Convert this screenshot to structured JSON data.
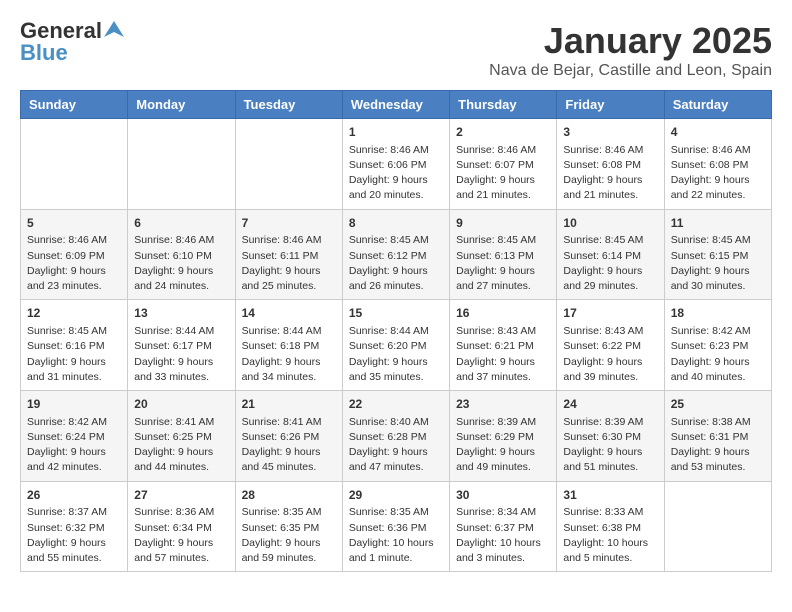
{
  "header": {
    "logo_general": "General",
    "logo_blue": "Blue",
    "title": "January 2025",
    "subtitle": "Nava de Bejar, Castille and Leon, Spain"
  },
  "calendar": {
    "headers": [
      "Sunday",
      "Monday",
      "Tuesday",
      "Wednesday",
      "Thursday",
      "Friday",
      "Saturday"
    ],
    "weeks": [
      [
        {
          "day": "",
          "content": ""
        },
        {
          "day": "",
          "content": ""
        },
        {
          "day": "",
          "content": ""
        },
        {
          "day": "1",
          "content": "Sunrise: 8:46 AM\nSunset: 6:06 PM\nDaylight: 9 hours\nand 20 minutes."
        },
        {
          "day": "2",
          "content": "Sunrise: 8:46 AM\nSunset: 6:07 PM\nDaylight: 9 hours\nand 21 minutes."
        },
        {
          "day": "3",
          "content": "Sunrise: 8:46 AM\nSunset: 6:08 PM\nDaylight: 9 hours\nand 21 minutes."
        },
        {
          "day": "4",
          "content": "Sunrise: 8:46 AM\nSunset: 6:08 PM\nDaylight: 9 hours\nand 22 minutes."
        }
      ],
      [
        {
          "day": "5",
          "content": "Sunrise: 8:46 AM\nSunset: 6:09 PM\nDaylight: 9 hours\nand 23 minutes."
        },
        {
          "day": "6",
          "content": "Sunrise: 8:46 AM\nSunset: 6:10 PM\nDaylight: 9 hours\nand 24 minutes."
        },
        {
          "day": "7",
          "content": "Sunrise: 8:46 AM\nSunset: 6:11 PM\nDaylight: 9 hours\nand 25 minutes."
        },
        {
          "day": "8",
          "content": "Sunrise: 8:45 AM\nSunset: 6:12 PM\nDaylight: 9 hours\nand 26 minutes."
        },
        {
          "day": "9",
          "content": "Sunrise: 8:45 AM\nSunset: 6:13 PM\nDaylight: 9 hours\nand 27 minutes."
        },
        {
          "day": "10",
          "content": "Sunrise: 8:45 AM\nSunset: 6:14 PM\nDaylight: 9 hours\nand 29 minutes."
        },
        {
          "day": "11",
          "content": "Sunrise: 8:45 AM\nSunset: 6:15 PM\nDaylight: 9 hours\nand 30 minutes."
        }
      ],
      [
        {
          "day": "12",
          "content": "Sunrise: 8:45 AM\nSunset: 6:16 PM\nDaylight: 9 hours\nand 31 minutes."
        },
        {
          "day": "13",
          "content": "Sunrise: 8:44 AM\nSunset: 6:17 PM\nDaylight: 9 hours\nand 33 minutes."
        },
        {
          "day": "14",
          "content": "Sunrise: 8:44 AM\nSunset: 6:18 PM\nDaylight: 9 hours\nand 34 minutes."
        },
        {
          "day": "15",
          "content": "Sunrise: 8:44 AM\nSunset: 6:20 PM\nDaylight: 9 hours\nand 35 minutes."
        },
        {
          "day": "16",
          "content": "Sunrise: 8:43 AM\nSunset: 6:21 PM\nDaylight: 9 hours\nand 37 minutes."
        },
        {
          "day": "17",
          "content": "Sunrise: 8:43 AM\nSunset: 6:22 PM\nDaylight: 9 hours\nand 39 minutes."
        },
        {
          "day": "18",
          "content": "Sunrise: 8:42 AM\nSunset: 6:23 PM\nDaylight: 9 hours\nand 40 minutes."
        }
      ],
      [
        {
          "day": "19",
          "content": "Sunrise: 8:42 AM\nSunset: 6:24 PM\nDaylight: 9 hours\nand 42 minutes."
        },
        {
          "day": "20",
          "content": "Sunrise: 8:41 AM\nSunset: 6:25 PM\nDaylight: 9 hours\nand 44 minutes."
        },
        {
          "day": "21",
          "content": "Sunrise: 8:41 AM\nSunset: 6:26 PM\nDaylight: 9 hours\nand 45 minutes."
        },
        {
          "day": "22",
          "content": "Sunrise: 8:40 AM\nSunset: 6:28 PM\nDaylight: 9 hours\nand 47 minutes."
        },
        {
          "day": "23",
          "content": "Sunrise: 8:39 AM\nSunset: 6:29 PM\nDaylight: 9 hours\nand 49 minutes."
        },
        {
          "day": "24",
          "content": "Sunrise: 8:39 AM\nSunset: 6:30 PM\nDaylight: 9 hours\nand 51 minutes."
        },
        {
          "day": "25",
          "content": "Sunrise: 8:38 AM\nSunset: 6:31 PM\nDaylight: 9 hours\nand 53 minutes."
        }
      ],
      [
        {
          "day": "26",
          "content": "Sunrise: 8:37 AM\nSunset: 6:32 PM\nDaylight: 9 hours\nand 55 minutes."
        },
        {
          "day": "27",
          "content": "Sunrise: 8:36 AM\nSunset: 6:34 PM\nDaylight: 9 hours\nand 57 minutes."
        },
        {
          "day": "28",
          "content": "Sunrise: 8:35 AM\nSunset: 6:35 PM\nDaylight: 9 hours\nand 59 minutes."
        },
        {
          "day": "29",
          "content": "Sunrise: 8:35 AM\nSunset: 6:36 PM\nDaylight: 10 hours\nand 1 minute."
        },
        {
          "day": "30",
          "content": "Sunrise: 8:34 AM\nSunset: 6:37 PM\nDaylight: 10 hours\nand 3 minutes."
        },
        {
          "day": "31",
          "content": "Sunrise: 8:33 AM\nSunset: 6:38 PM\nDaylight: 10 hours\nand 5 minutes."
        },
        {
          "day": "",
          "content": ""
        }
      ]
    ]
  }
}
